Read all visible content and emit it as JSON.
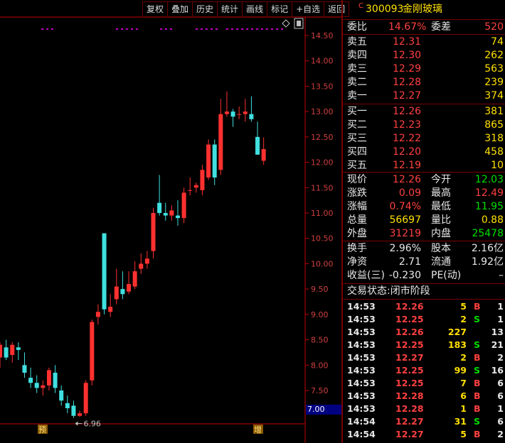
{
  "toolbar": [
    "复权",
    "叠加",
    "历史",
    "统计",
    "画线",
    "标记",
    "+自选",
    "返回"
  ],
  "chart": {
    "y_ticks": [
      "14.50",
      "14.00",
      "13.50",
      "13.00",
      "12.50",
      "12.00",
      "11.50",
      "11.00",
      "10.50",
      "10.00",
      "9.50",
      "9.00",
      "8.50",
      "8.00",
      "7.50"
    ],
    "current_price_tag": "7.00",
    "low_annotation": "6.96",
    "markers": [
      "预",
      "增"
    ],
    "colors": {
      "up": "#ff3030",
      "down": "#40e0e0",
      "axis": "#c00000",
      "dots": "#c000c0"
    }
  },
  "chart_data": {
    "type": "candlestick",
    "ylim": [
      6.8,
      14.8
    ],
    "candles": [
      {
        "o": 8.15,
        "h": 8.45,
        "l": 7.95,
        "c": 8.4
      },
      {
        "o": 8.35,
        "h": 8.5,
        "l": 8.1,
        "c": 8.15
      },
      {
        "o": 8.2,
        "h": 8.45,
        "l": 8.05,
        "c": 8.4
      },
      {
        "o": 8.35,
        "h": 8.45,
        "l": 8.1,
        "c": 8.3
      },
      {
        "o": 8.0,
        "h": 8.25,
        "l": 7.75,
        "c": 7.85
      },
      {
        "o": 7.75,
        "h": 7.95,
        "l": 7.55,
        "c": 7.65
      },
      {
        "o": 7.65,
        "h": 7.8,
        "l": 7.45,
        "c": 7.55
      },
      {
        "o": 7.55,
        "h": 7.7,
        "l": 7.4,
        "c": 7.6
      },
      {
        "o": 7.6,
        "h": 7.95,
        "l": 7.5,
        "c": 7.9
      },
      {
        "o": 7.85,
        "h": 8.0,
        "l": 7.45,
        "c": 7.55
      },
      {
        "o": 7.5,
        "h": 7.6,
        "l": 7.2,
        "c": 7.3
      },
      {
        "o": 7.25,
        "h": 7.4,
        "l": 7.05,
        "c": 7.15
      },
      {
        "o": 7.2,
        "h": 7.3,
        "l": 6.96,
        "c": 7.0
      },
      {
        "o": 7.0,
        "h": 7.1,
        "l": 6.98,
        "c": 7.05
      },
      {
        "o": 7.05,
        "h": 7.7,
        "l": 7.0,
        "c": 7.65
      },
      {
        "o": 7.7,
        "h": 8.9,
        "l": 7.6,
        "c": 8.85
      },
      {
        "o": 8.95,
        "h": 9.2,
        "l": 8.8,
        "c": 9.05
      },
      {
        "o": 10.6,
        "h": 10.6,
        "l": 9.0,
        "c": 9.1
      },
      {
        "o": 9.05,
        "h": 9.4,
        "l": 8.95,
        "c": 9.15
      },
      {
        "o": 9.3,
        "h": 9.9,
        "l": 9.2,
        "c": 9.55
      },
      {
        "o": 9.5,
        "h": 9.85,
        "l": 9.3,
        "c": 9.4
      },
      {
        "o": 9.45,
        "h": 9.85,
        "l": 9.4,
        "c": 9.6
      },
      {
        "o": 9.55,
        "h": 10.05,
        "l": 9.5,
        "c": 9.85
      },
      {
        "o": 9.9,
        "h": 10.2,
        "l": 9.8,
        "c": 10.0
      },
      {
        "o": 10.0,
        "h": 10.25,
        "l": 9.9,
        "c": 10.1
      },
      {
        "o": 10.25,
        "h": 11.1,
        "l": 10.1,
        "c": 11.0
      },
      {
        "o": 11.2,
        "h": 11.75,
        "l": 10.95,
        "c": 11.0
      },
      {
        "o": 11.0,
        "h": 11.2,
        "l": 10.85,
        "c": 10.95
      },
      {
        "o": 10.95,
        "h": 11.15,
        "l": 10.85,
        "c": 11.05
      },
      {
        "o": 10.95,
        "h": 11.25,
        "l": 10.75,
        "c": 10.9
      },
      {
        "o": 10.9,
        "h": 11.5,
        "l": 10.8,
        "c": 11.4
      },
      {
        "o": 11.45,
        "h": 11.7,
        "l": 11.35,
        "c": 11.45
      },
      {
        "o": 11.5,
        "h": 11.6,
        "l": 11.4,
        "c": 11.55
      },
      {
        "o": 11.45,
        "h": 11.95,
        "l": 11.35,
        "c": 11.85
      },
      {
        "o": 11.7,
        "h": 12.45,
        "l": 11.65,
        "c": 12.35
      },
      {
        "o": 12.35,
        "h": 12.45,
        "l": 11.55,
        "c": 11.7
      },
      {
        "o": 11.85,
        "h": 13.25,
        "l": 11.75,
        "c": 12.95
      },
      {
        "o": 12.95,
        "h": 13.4,
        "l": 12.9,
        "c": 13.0
      },
      {
        "o": 13.0,
        "h": 13.05,
        "l": 12.7,
        "c": 12.9
      },
      {
        "o": 12.95,
        "h": 13.1,
        "l": 12.85,
        "c": 12.95
      },
      {
        "o": 12.95,
        "h": 13.25,
        "l": 12.8,
        "c": 13.0
      },
      {
        "o": 12.95,
        "h": 13.3,
        "l": 12.8,
        "c": 12.85
      },
      {
        "o": 12.5,
        "h": 12.8,
        "l": 12.15,
        "c": 12.15
      },
      {
        "o": 12.03,
        "h": 12.49,
        "l": 11.95,
        "c": 12.26
      }
    ]
  },
  "quote": {
    "code_prefix": "C",
    "code": "300093",
    "name": "金刚玻璃",
    "weibi_label": "委比",
    "weibi_value": "14.67%",
    "weicha_label": "委差",
    "weicha_value": "520",
    "sell": [
      {
        "label": "卖五",
        "price": "12.31",
        "vol": "74"
      },
      {
        "label": "卖四",
        "price": "12.30",
        "vol": "262"
      },
      {
        "label": "卖三",
        "price": "12.29",
        "vol": "563"
      },
      {
        "label": "卖二",
        "price": "12.28",
        "vol": "239"
      },
      {
        "label": "卖一",
        "price": "12.27",
        "vol": "374"
      }
    ],
    "buy": [
      {
        "label": "买一",
        "price": "12.26",
        "vol": "381"
      },
      {
        "label": "买二",
        "price": "12.23",
        "vol": "865"
      },
      {
        "label": "买三",
        "price": "12.22",
        "vol": "318"
      },
      {
        "label": "买四",
        "price": "12.20",
        "vol": "458"
      },
      {
        "label": "买五",
        "price": "12.19",
        "vol": "10"
      }
    ],
    "stats": [
      {
        "l1": "现价",
        "v1": "12.26",
        "c1": "red",
        "l2": "今开",
        "v2": "12.03",
        "c2": "green"
      },
      {
        "l1": "涨跌",
        "v1": "0.09",
        "c1": "red",
        "l2": "最高",
        "v2": "12.49",
        "c2": "red"
      },
      {
        "l1": "涨幅",
        "v1": "0.74%",
        "c1": "red",
        "l2": "最低",
        "v2": "11.95",
        "c2": "green"
      },
      {
        "l1": "总量",
        "v1": "56697",
        "c1": "yellow",
        "l2": "量比",
        "v2": "0.88",
        "c2": "yellow"
      },
      {
        "l1": "外盘",
        "v1": "31219",
        "c1": "red",
        "l2": "内盘",
        "v2": "25478",
        "c2": "green"
      }
    ],
    "fin": [
      {
        "l1": "换手",
        "v1": "2.96%",
        "l2": "股本",
        "v2": "2.16亿"
      },
      {
        "l1": "净资",
        "v1": "2.71",
        "l2": "流通",
        "v2": "1.92亿"
      },
      {
        "l1": "收益(三)",
        "v1": "-0.230",
        "l2": "PE(动)",
        "v2": "–"
      }
    ],
    "trade_status": "交易状态:闭市阶段",
    "trades": [
      {
        "time": "14:53",
        "price": "12.26",
        "vol": "5",
        "bs": "B",
        "n": "1"
      },
      {
        "time": "14:53",
        "price": "12.25",
        "vol": "2",
        "bs": "S",
        "n": "1"
      },
      {
        "time": "14:53",
        "price": "12.26",
        "vol": "227",
        "bs": "",
        "n": "13"
      },
      {
        "time": "14:53",
        "price": "12.25",
        "vol": "183",
        "bs": "S",
        "n": "21"
      },
      {
        "time": "14:53",
        "price": "12.27",
        "vol": "2",
        "bs": "B",
        "n": "2"
      },
      {
        "time": "14:53",
        "price": "12.25",
        "vol": "99",
        "bs": "S",
        "n": "16"
      },
      {
        "time": "14:53",
        "price": "12.25",
        "vol": "7",
        "bs": "B",
        "n": "6"
      },
      {
        "time": "14:53",
        "price": "12.28",
        "vol": "6",
        "bs": "B",
        "n": "6"
      },
      {
        "time": "14:53",
        "price": "12.28",
        "vol": "1",
        "bs": "B",
        "n": "1"
      },
      {
        "time": "14:54",
        "price": "12.27",
        "vol": "31",
        "bs": "S",
        "n": "6"
      },
      {
        "time": "14:54",
        "price": "12.27",
        "vol": "5",
        "bs": "B",
        "n": "2"
      }
    ]
  }
}
